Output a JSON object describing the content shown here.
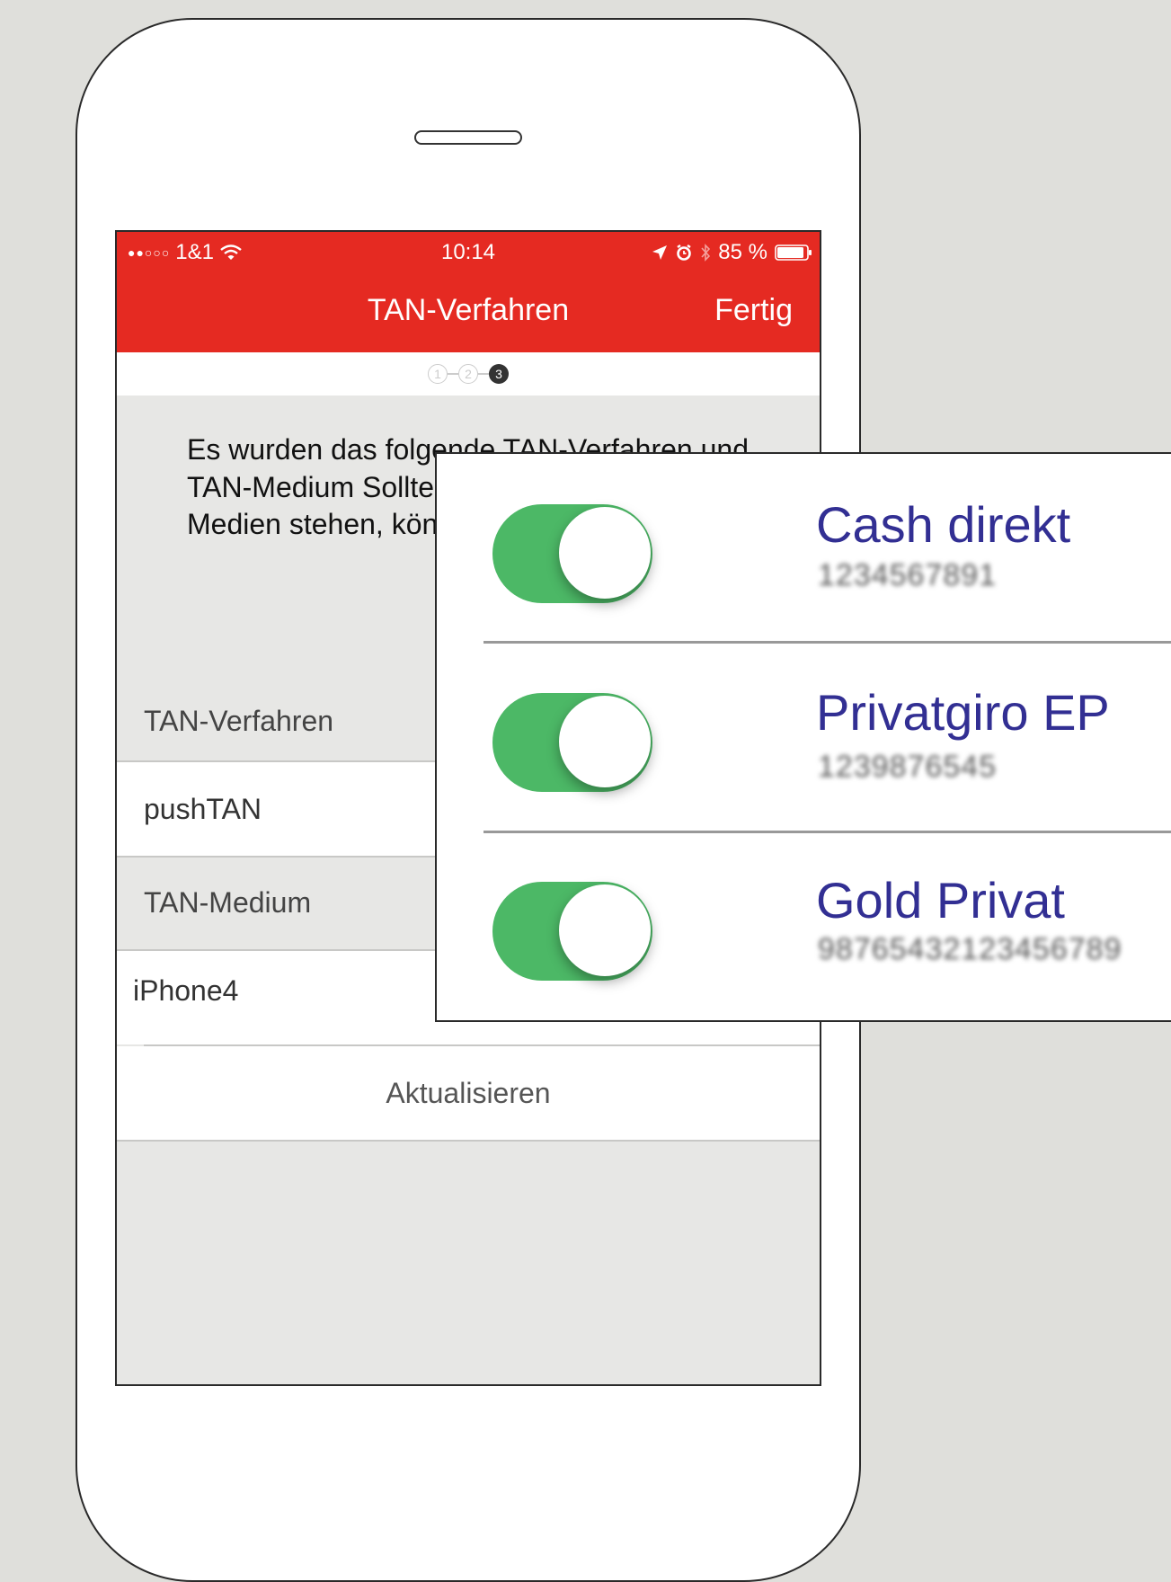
{
  "status_bar": {
    "carrier": "1&1",
    "time": "10:14",
    "battery": "85 %"
  },
  "nav": {
    "title": "TAN-Verfahren",
    "done_label": "Fertig"
  },
  "steps": [
    "1",
    "2",
    "3"
  ],
  "current_step": 3,
  "description": "Es wurden das folgende TAN-Verfahren und TAN-Medium Sollten mehrere T oder TAN-Medien stehen, können S Standardeinstellu",
  "sections": {
    "method_header": "TAN-Verfahren",
    "method_value": "pushTAN",
    "medium_header": "TAN-Medium",
    "medium_value": "iPhone4"
  },
  "refresh_label": "Aktualisieren",
  "accounts": [
    {
      "name": "Cash direkt",
      "number": "1234567891",
      "enabled": true
    },
    {
      "name": "Privatgiro EP",
      "number": "1239876545",
      "enabled": true
    },
    {
      "name": "Gold Privat",
      "number": "98765432123456789",
      "enabled": true
    }
  ],
  "colors": {
    "nav_red": "#e52a22",
    "toggle_green": "#4cb866",
    "account_blue": "#322f93"
  },
  "icons": [
    "signal-dots-icon",
    "wifi-icon",
    "location-arrow-icon",
    "alarm-icon",
    "bluetooth-icon",
    "battery-icon"
  ]
}
